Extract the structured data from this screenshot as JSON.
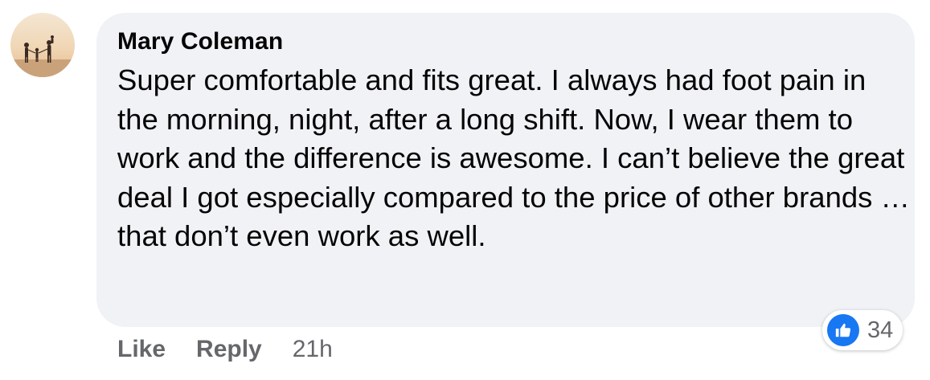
{
  "comment": {
    "author": "Mary Coleman",
    "text": "Super comfortable and fits great. I always had foot pain in the morning, night, after a long shift. Now, I wear them to work and the difference is awesome. I can’t believe the great deal I got especially compared to the price of other brands … that don’t even work as well.",
    "avatar_icon": "profile-photo-silhouettes-sunset",
    "reactions": {
      "icon": "thumbs-up-icon",
      "count": "34",
      "color": "#1877f2"
    },
    "actions": {
      "like_label": "Like",
      "reply_label": "Reply",
      "timestamp": "21h"
    }
  }
}
